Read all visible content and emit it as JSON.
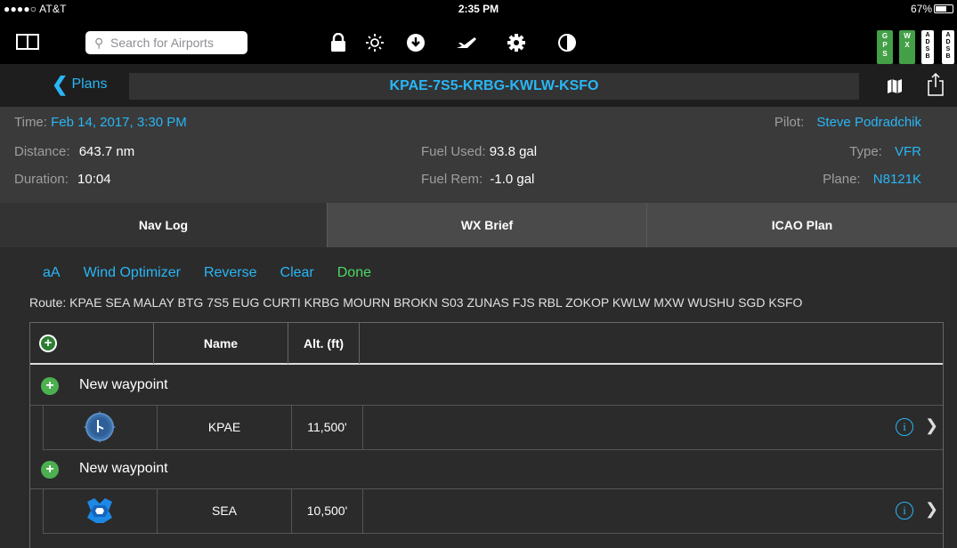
{
  "status_bar": {
    "carrier": "●●●●○ AT&T",
    "time": "2:35 PM",
    "battery": "67%",
    "battery_fraction": 0.67
  },
  "toolbar": {
    "search_placeholder": "Search for Airports",
    "icons": [
      "sidebar-icon",
      "lock-icon",
      "brightness-icon",
      "download-icon",
      "airplane-icon",
      "gear-icon",
      "contrast-icon"
    ],
    "gps_badges": [
      {
        "letters": [
          "G",
          "P",
          "S"
        ],
        "color": "#43a047"
      },
      {
        "letters": [
          "W",
          "X"
        ],
        "color": "#43a047"
      },
      {
        "letters": [
          "A",
          "D",
          "S",
          "B"
        ],
        "color": "#ffffff"
      },
      {
        "letters": [
          "A",
          "D",
          "S",
          "B"
        ],
        "color": "#ffffff"
      }
    ]
  },
  "navbar": {
    "back_label": "Plans",
    "title": "KPAE-7S5-KRBG-KWLW-KSFO"
  },
  "plan_info": {
    "time_label": "Time:",
    "time_value": "Feb 14, 2017, 3:30 PM",
    "distance_label": "Distance:",
    "distance_value": "643.7 nm",
    "duration_label": "Duration:",
    "duration_value": "10:04",
    "fuel_used_label": "Fuel Used:",
    "fuel_used_value": "93.8 gal",
    "fuel_rem_label": "Fuel Rem:",
    "fuel_rem_value": "-1.0 gal",
    "pilot_label": "Pilot:",
    "pilot_value": "Steve Podradchik",
    "type_label": "Type:",
    "type_value": "VFR",
    "plane_label": "Plane:",
    "plane_value": "N8121K"
  },
  "tabs": [
    {
      "label": "Nav Log",
      "active": true
    },
    {
      "label": "WX Brief",
      "active": false
    },
    {
      "label": "ICAO Plan",
      "active": false
    }
  ],
  "actions": {
    "font_size": "aA",
    "wind_optimizer": "Wind Optimizer",
    "reverse": "Reverse",
    "clear": "Clear",
    "done": "Done"
  },
  "route": "Route: KPAE SEA MALAY BTG 7S5 EUG CURTI KRBG MOURN BROKN S03 ZUNAS FJS RBL ZOKOP KWLW MXW WUSHU SGD KSFO",
  "table": {
    "headers": {
      "name": "Name",
      "alt": "Alt. (ft)"
    },
    "new_waypoint_label": "New waypoint",
    "rows": [
      {
        "name": "KPAE",
        "alt": "11,500'",
        "icon": "airport-icon"
      },
      {
        "name": "SEA",
        "alt": "10,500'",
        "icon": "vortac-icon"
      }
    ]
  },
  "colors": {
    "accent_blue": "#29b6f6",
    "done_green": "#4cd964",
    "add_green": "#4caf50"
  }
}
